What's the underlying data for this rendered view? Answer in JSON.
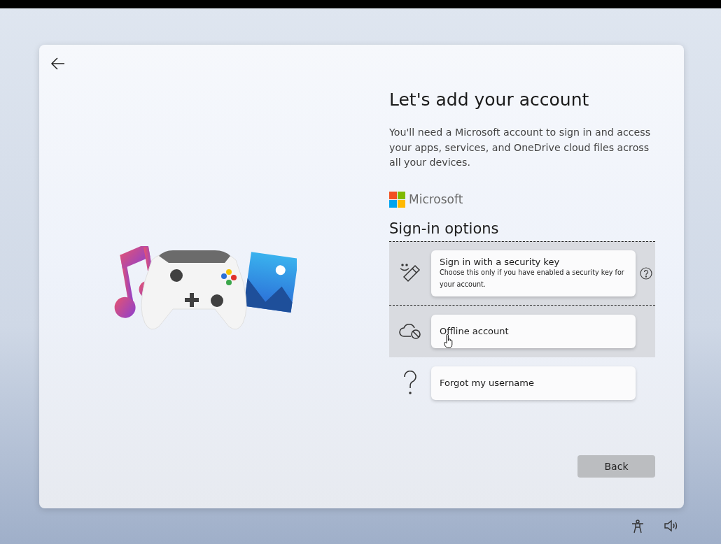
{
  "title": "Let's add your account",
  "description": "You'll need a Microsoft account to sign in and access your apps, services, and OneDrive cloud files across all your devices.",
  "brand": "Microsoft",
  "section_title": "Sign-in options",
  "options": [
    {
      "kind": "security-key",
      "label": "Sign in with a security key",
      "detail": "Choose this only if you have enabled a security key for your account.",
      "focused": true,
      "hovered": false,
      "has_help": true
    },
    {
      "kind": "offline",
      "label": "Offline account",
      "focused": false,
      "hovered": true,
      "has_help": false
    },
    {
      "kind": "forgot",
      "label": "Forgot my username",
      "focused": false,
      "hovered": false,
      "has_help": false
    }
  ],
  "back_button": "Back"
}
